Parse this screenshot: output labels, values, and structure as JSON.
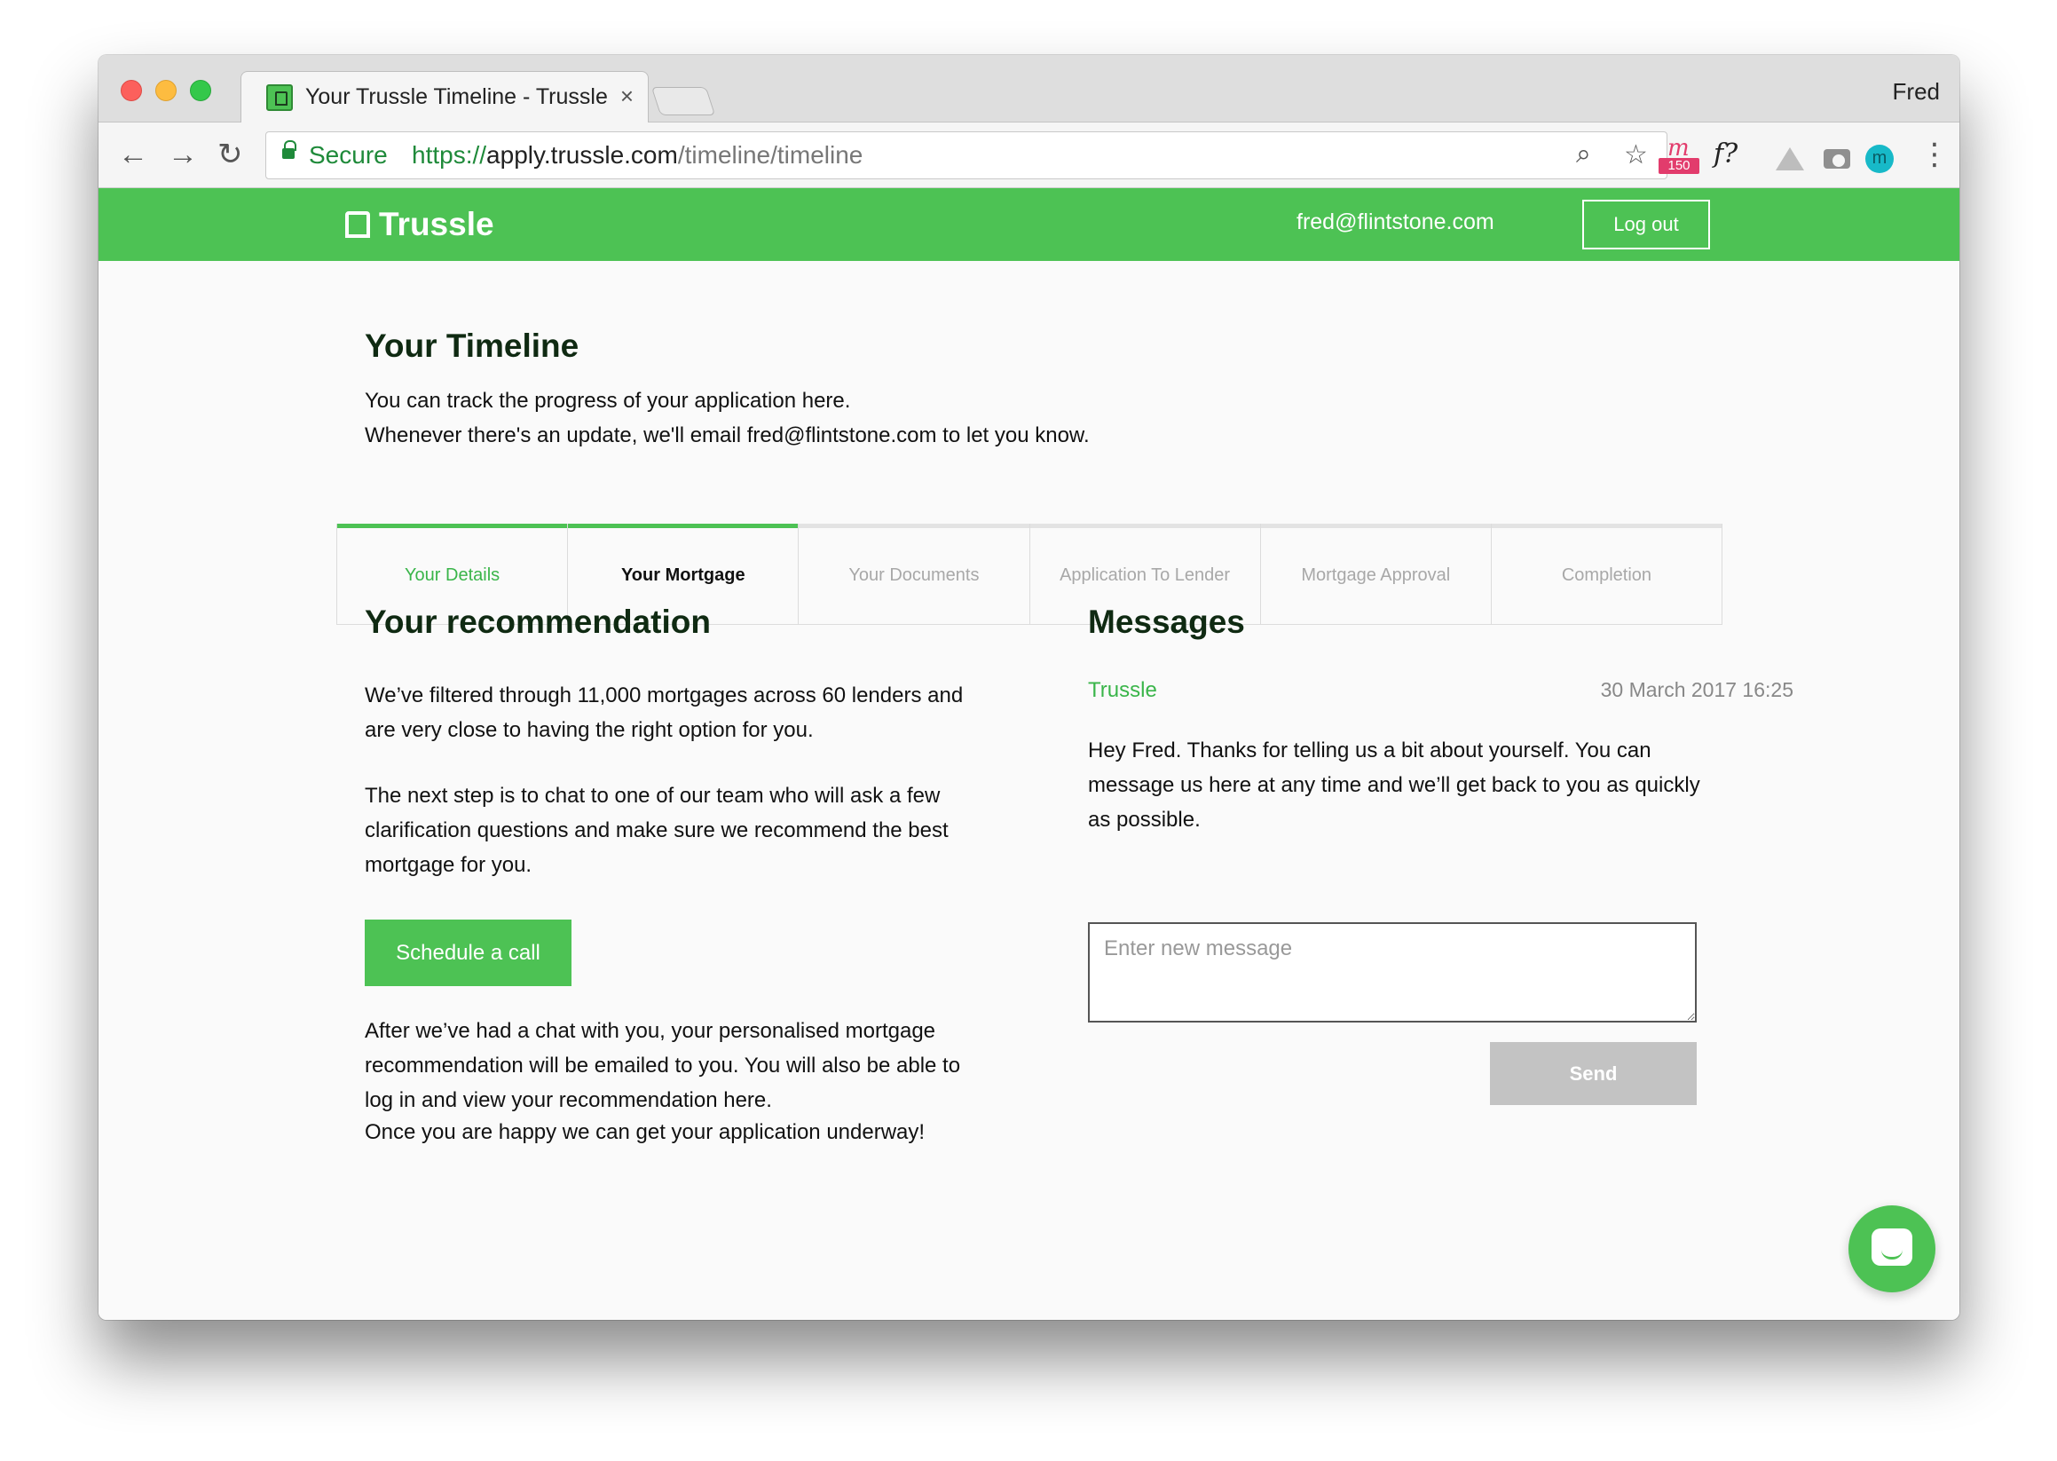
{
  "browser": {
    "tab_title": "Your Trussle Timeline - Trussle",
    "tab_close": "×",
    "profile_name": "Fred",
    "back": "←",
    "forward": "→",
    "reload": "↻",
    "secure_label": "Secure",
    "url_protocol": "https://",
    "url_host": "apply.trussle.com",
    "url_path": "/timeline/timeline",
    "zoom_icon": "⌕",
    "star_icon": "☆",
    "ext_badge_letter": "m",
    "ext_badge_count": "150",
    "ext_f_label": "f?",
    "ext_m_label": "m",
    "menu_icon": "⋮"
  },
  "header": {
    "logo_text": "Trussle",
    "user_email": "fred@flintstone.com",
    "logout_label": "Log out",
    "brand_color": "#4dc254"
  },
  "timeline": {
    "title": "Your Timeline",
    "subtitle_line1": "You can track the progress of your application here.",
    "subtitle_line2": "Whenever there's an update, we'll email fred@flintstone.com to let you know.",
    "progress_fraction": 0.333,
    "steps": [
      {
        "label": "Your Details",
        "state": "done"
      },
      {
        "label": "Your Mortgage",
        "state": "current"
      },
      {
        "label": "Your Documents",
        "state": "pending"
      },
      {
        "label": "Application To Lender",
        "state": "pending"
      },
      {
        "label": "Mortgage Approval",
        "state": "pending"
      },
      {
        "label": "Completion",
        "state": "pending"
      }
    ]
  },
  "recommendation": {
    "title": "Your recommendation",
    "para1": "We’ve filtered through 11,000 mortgages across 60 lenders and are very close to having the right option for you.",
    "para2": "The next step is to chat to one of our team who will ask a few clarification questions and make sure we recommend the best mortgage for you.",
    "schedule_label": "Schedule a call",
    "para3": "After we’ve had a chat with you, your personalised mortgage recommendation will be emailed to you. You will also be able to log in and view your recommendation here.",
    "para4": "Once you are happy we can get your application underway!"
  },
  "messages": {
    "title": "Messages",
    "sender": "Trussle",
    "date": "30 March 2017 16:25",
    "body": "Hey Fred. Thanks for telling us a bit about yourself. You can message us here at any time and we’ll get back to you as quickly as possible.",
    "input_placeholder": "Enter new message",
    "send_label": "Send"
  }
}
